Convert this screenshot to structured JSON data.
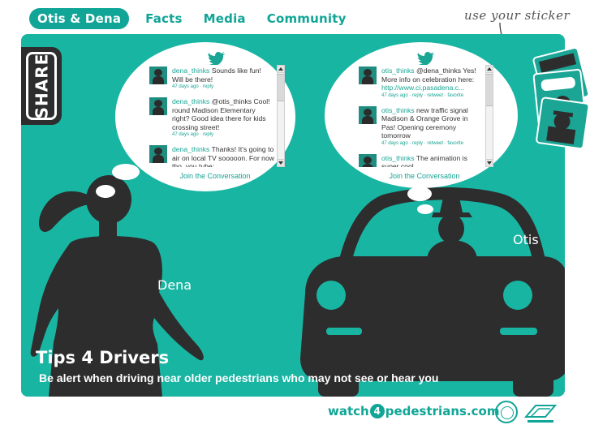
{
  "nav": {
    "items": [
      {
        "label": "Otis & Dena",
        "active": true
      },
      {
        "label": "Facts",
        "active": false
      },
      {
        "label": "Media",
        "active": false
      },
      {
        "label": "Community",
        "active": false
      }
    ]
  },
  "sticker_note": "use your sticker",
  "share_label": "SHARE",
  "dena_feed": {
    "tweets": [
      {
        "user": "dena_thinks",
        "text": " Sounds like fun! Will be there!",
        "meta": "47 days ago · reply"
      },
      {
        "user": "dena_thinks",
        "text": " @otis_thinks Cool! round Madison Elementary right? Good idea there for kids crossing street!",
        "meta": "47 days ago · reply"
      },
      {
        "user": "dena_thinks",
        "text": " Thanks! It's going to air on local TV sooooon. For now tho, you tube:",
        "meta": ""
      }
    ],
    "join": "Join the Conversation"
  },
  "otis_feed": {
    "tweets": [
      {
        "user": "otis_thinks",
        "text": " @dena_thinks Yes! More info on celebration here: ",
        "link": "http://www.ci.pasadena.c...",
        "meta": "47 days ago · reply · retweet · favorite"
      },
      {
        "user": "otis_thinks",
        "text": " new traffic signal Madison & Orange Grove in Pas! Opening ceremony tomorrow",
        "link": "",
        "meta": "47 days ago · reply · retweet · favorite"
      },
      {
        "user": "otis_thinks",
        "text": " The animation is super cool",
        "link": "",
        "meta": ""
      }
    ],
    "join": "Join the Conversation"
  },
  "characters": {
    "dena": "Dena",
    "otis": "Otis"
  },
  "tips": {
    "title": "Tips 4 Drivers",
    "subtitle": "Be alert when driving near older pedestrians who may not see or hear you"
  },
  "footer": {
    "site_pre": "watch",
    "site_four": "4",
    "site_post": "pedestrians.com"
  },
  "colors": {
    "teal": "#19b5a3",
    "nav_teal": "#10a596",
    "silhouette": "#2d2d2d"
  }
}
